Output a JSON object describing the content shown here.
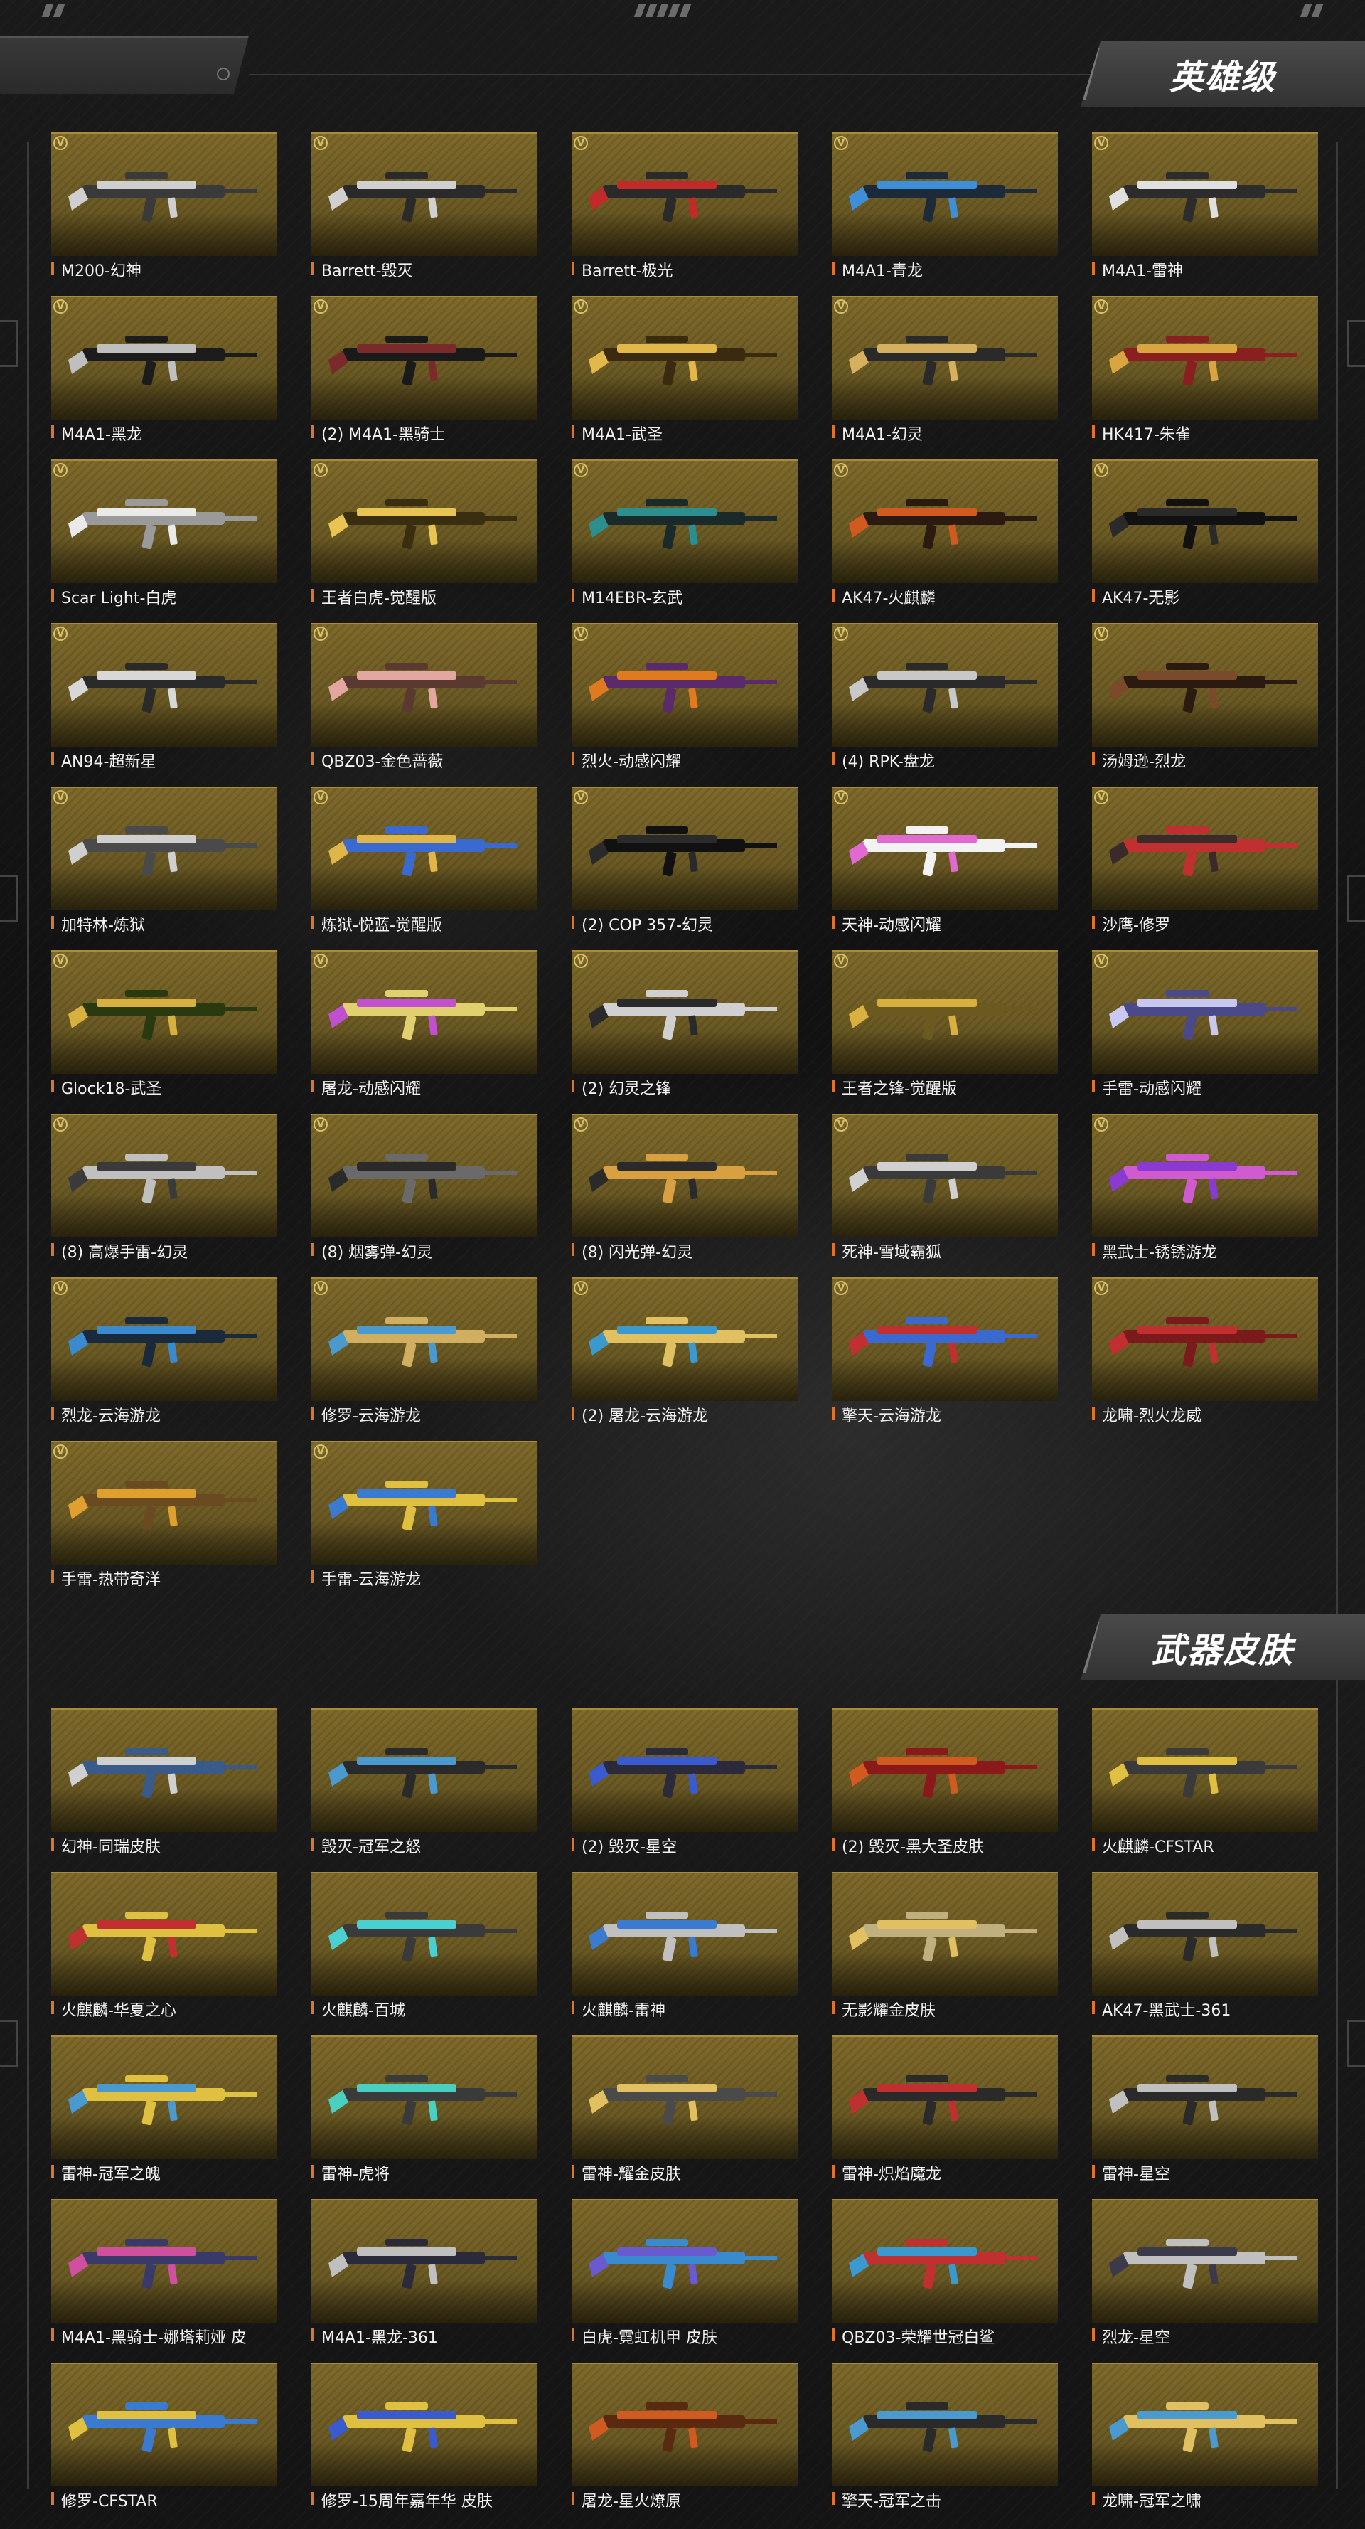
{
  "sections": [
    {
      "title": "英雄级",
      "items": [
        {
          "name": "M200-幻神",
          "colors": [
            "#cfcfcf",
            "#3a3a3a"
          ]
        },
        {
          "name": "Barrett-毁灭",
          "colors": [
            "#d0d0d0",
            "#2a2a2a"
          ]
        },
        {
          "name": "Barrett-极光",
          "colors": [
            "#c22a2a",
            "#2a2a2a"
          ]
        },
        {
          "name": "M4A1-青龙",
          "colors": [
            "#3f8fd8",
            "#1d2a3a"
          ]
        },
        {
          "name": "M4A1-雷神",
          "colors": [
            "#e0e0e0",
            "#2c2c2c"
          ]
        },
        {
          "name": "M4A1-黑龙",
          "colors": [
            "#bfbfbf",
            "#1c1c1c"
          ]
        },
        {
          "name": "(2) M4A1-黑骑士",
          "colors": [
            "#7a2a2a",
            "#1a1a1a"
          ]
        },
        {
          "name": "M4A1-武圣",
          "colors": [
            "#e2b84a",
            "#3a2a10"
          ]
        },
        {
          "name": "M4A1-幻灵",
          "colors": [
            "#d4b060",
            "#2a2a2a"
          ]
        },
        {
          "name": "HK417-朱雀",
          "colors": [
            "#d8a540",
            "#8a1f1f"
          ]
        },
        {
          "name": "Scar Light-白虎",
          "colors": [
            "#eaeaea",
            "#9a9a9a"
          ]
        },
        {
          "name": "王者白虎-觉醒版",
          "colors": [
            "#e8c552",
            "#3a2e10"
          ]
        },
        {
          "name": "M14EBR-玄武",
          "colors": [
            "#2c8f8f",
            "#1a2a2a"
          ]
        },
        {
          "name": "AK47-火麒麟",
          "colors": [
            "#d05a20",
            "#2a1a10"
          ]
        },
        {
          "name": "AK47-无影",
          "colors": [
            "#2a2a2a",
            "#111111"
          ]
        },
        {
          "name": "AN94-超新星",
          "colors": [
            "#d8d8d8",
            "#2a2a2a"
          ]
        },
        {
          "name": "QBZ03-金色蔷薇",
          "colors": [
            "#e2a7a0",
            "#5a3a30"
          ]
        },
        {
          "name": "烈火-动感闪耀",
          "colors": [
            "#e07a20",
            "#5a2a6a"
          ]
        },
        {
          "name": "(4) RPK-盘龙",
          "colors": [
            "#c8c8c8",
            "#2a2a2a"
          ]
        },
        {
          "name": "汤姆逊-烈龙",
          "colors": [
            "#7a4a2a",
            "#2a1a10"
          ]
        },
        {
          "name": "加特林-炼狱",
          "colors": [
            "#cfcfcf",
            "#4a4a4a"
          ]
        },
        {
          "name": "炼狱-悦蓝-觉醒版",
          "colors": [
            "#e0b64a",
            "#3a6ad0"
          ]
        },
        {
          "name": "(2) COP 357-幻灵",
          "colors": [
            "#2a2a2a",
            "#111111"
          ]
        },
        {
          "name": "天神-动感闪耀",
          "colors": [
            "#e06ad0",
            "#f2f2f2"
          ]
        },
        {
          "name": "沙鹰-修罗",
          "colors": [
            "#3a2a2a",
            "#c03030"
          ]
        },
        {
          "name": "Glock18-武圣",
          "colors": [
            "#d8b040",
            "#2a3a10"
          ]
        },
        {
          "name": "屠龙-动感闪耀",
          "colors": [
            "#c050d0",
            "#e0d070"
          ]
        },
        {
          "name": "(2) 幻灵之锋",
          "colors": [
            "#2a2a2a",
            "#d0d0d0"
          ]
        },
        {
          "name": "王者之锋-觉醒版",
          "colors": [
            "#d8b040",
            "#6a5a20"
          ]
        },
        {
          "name": "手雷-动感闪耀",
          "colors": [
            "#c8c8f0",
            "#4a4a8a"
          ]
        },
        {
          "name": "(8) 高爆手雷-幻灵",
          "colors": [
            "#3a3a3a",
            "#c0c0c0"
          ]
        },
        {
          "name": "(8) 烟雾弹-幻灵",
          "colors": [
            "#2a2a2a",
            "#6a6a6a"
          ]
        },
        {
          "name": "(8) 闪光弹-幻灵",
          "colors": [
            "#2a2a2a",
            "#d8a040"
          ]
        },
        {
          "name": "死神-雪域霸狐",
          "colors": [
            "#d0d0d0",
            "#3a3a3a"
          ]
        },
        {
          "name": "黑武士-锈锈游龙",
          "colors": [
            "#8a3ad0",
            "#d05ad0"
          ]
        },
        {
          "name": "烈龙-云海游龙",
          "colors": [
            "#3a8ad0",
            "#1a2a3a"
          ]
        },
        {
          "name": "修罗-云海游龙",
          "colors": [
            "#4a9ad0",
            "#d0b060"
          ]
        },
        {
          "name": "(2) 屠龙-云海游龙",
          "colors": [
            "#3a9ad0",
            "#e0c060"
          ]
        },
        {
          "name": "擎天-云海游龙",
          "colors": [
            "#c03030",
            "#3a6ad0"
          ]
        },
        {
          "name": "龙啸-烈火龙威",
          "colors": [
            "#c03030",
            "#7a1a1a"
          ]
        },
        {
          "name": "手雷-热带奇洋",
          "colors": [
            "#e0a030",
            "#6a4a20"
          ]
        },
        {
          "name": "手雷-云海游龙",
          "colors": [
            "#3a7ad0",
            "#e0c040"
          ]
        }
      ]
    },
    {
      "title": "武器皮肤",
      "items": [
        {
          "name": "幻神-同瑞皮肤",
          "colors": [
            "#d0d0d0",
            "#3a5a8a"
          ]
        },
        {
          "name": "毁灭-冠军之怒",
          "colors": [
            "#4a9ad0",
            "#2a2a2a"
          ]
        },
        {
          "name": "(2) 毁灭-星空",
          "colors": [
            "#3a5ad0",
            "#2a2a3a"
          ]
        },
        {
          "name": "(2) 毁灭-黑大圣皮肤",
          "colors": [
            "#d05a20",
            "#8a1a1a"
          ]
        },
        {
          "name": "火麒麟-CFSTAR",
          "colors": [
            "#e0c040",
            "#3a3a3a"
          ]
        },
        {
          "name": "火麒麟-华夏之心",
          "colors": [
            "#c03030",
            "#e0c040"
          ]
        },
        {
          "name": "火麒麟-百城",
          "colors": [
            "#4ad0d0",
            "#3a3a3a"
          ]
        },
        {
          "name": "火麒麟-雷神",
          "colors": [
            "#3a7ad0",
            "#c0c0c0"
          ]
        },
        {
          "name": "无影耀金皮肤",
          "colors": [
            "#e0c060",
            "#c0b080"
          ]
        },
        {
          "name": "AK47-黑武士-361",
          "colors": [
            "#c0c0c0",
            "#2a2a2a"
          ]
        },
        {
          "name": "雷神-冠军之魄",
          "colors": [
            "#4a9ad0",
            "#e0c040"
          ]
        },
        {
          "name": "雷神-虎将",
          "colors": [
            "#4ad0c0",
            "#3a3a3a"
          ]
        },
        {
          "name": "雷神-耀金皮肤",
          "colors": [
            "#e0c060",
            "#4a4a4a"
          ]
        },
        {
          "name": "雷神-炽焰魔龙",
          "colors": [
            "#c03030",
            "#2a2a2a"
          ]
        },
        {
          "name": "雷神-星空",
          "colors": [
            "#c0c0c0",
            "#2a2a2a"
          ]
        },
        {
          "name": "M4A1-黑骑士-娜塔莉娅 皮",
          "colors": [
            "#d050a0",
            "#3a3a6a"
          ]
        },
        {
          "name": "M4A1-黑龙-361",
          "colors": [
            "#c0c0c0",
            "#2a2a3a"
          ]
        },
        {
          "name": "白虎-霓虹机甲 皮肤",
          "colors": [
            "#6a5ad0",
            "#3a8ad0"
          ]
        },
        {
          "name": "QBZ03-荣耀世冠白鲨",
          "colors": [
            "#3a9ad0",
            "#c03030"
          ]
        },
        {
          "name": "烈龙-星空",
          "colors": [
            "#3a3a4a",
            "#c0c0c0"
          ]
        },
        {
          "name": "修罗-CFSTAR",
          "colors": [
            "#e0c040",
            "#3a7ad0"
          ]
        },
        {
          "name": "修罗-15周年嘉年华 皮肤",
          "colors": [
            "#3a5ad0",
            "#e0c040"
          ]
        },
        {
          "name": "屠龙-星火燎原",
          "colors": [
            "#d05a20",
            "#5a2a10"
          ]
        },
        {
          "name": "擎天-冠军之击",
          "colors": [
            "#4a9ad0",
            "#2a2a2a"
          ]
        },
        {
          "name": "龙啸-冠军之啸",
          "colors": [
            "#4a9ad0",
            "#e0c060"
          ]
        }
      ]
    }
  ]
}
